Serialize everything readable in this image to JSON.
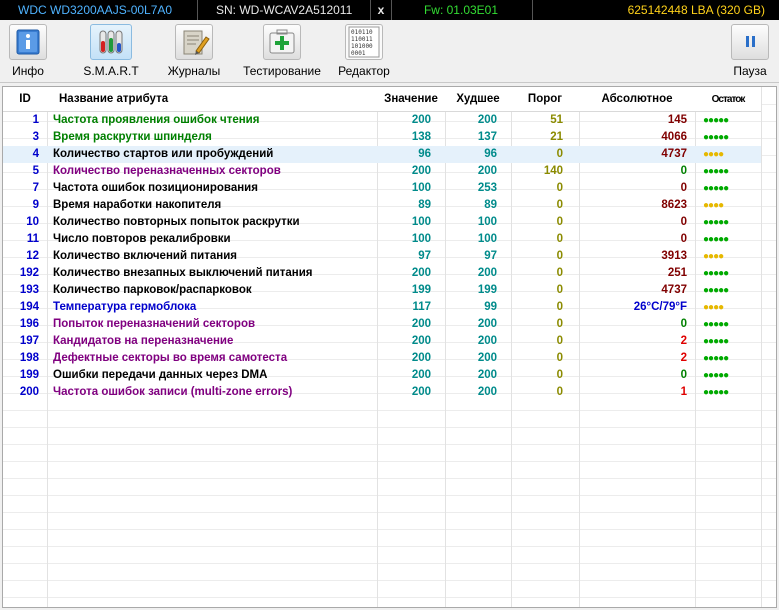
{
  "topbar": {
    "model": "WDC WD3200AAJS-00L7A0",
    "serial": "SN: WD-WCAV2A512011",
    "close": "x",
    "firmware": "Fw: 01.03E01",
    "capacity": "625142448 LBA (320 GB)"
  },
  "toolbar": {
    "info": "Инфо",
    "smart": "S.M.A.R.T",
    "logs": "Журналы",
    "test": "Тестирование",
    "editor": "Редактор",
    "pause": "Пауза",
    "editor_icon_text": [
      "010110",
      "110011",
      "101000",
      "0001"
    ]
  },
  "colors": {
    "teal": "#008b8b",
    "threshold": "#8b8b00",
    "green_name": "#008000",
    "purple_name": "#800080",
    "blue_name": "#0000cc",
    "absolute_red": "#800000",
    "absolute_green": "#008000",
    "bright_red": "#e00000",
    "dots_green": "#00aa00",
    "dots_yellow": "#e6b800",
    "selected_row": "#e5f1fb"
  },
  "table": {
    "headers": {
      "id": "ID",
      "name": "Название атрибута",
      "value": "Значение",
      "worst": "Худшее",
      "threshold": "Порог",
      "absolute": "Абсолютное",
      "remaining": "Остаток"
    },
    "rows": [
      {
        "id": "1",
        "name": "Частота проявления ошибок чтения",
        "value": "200",
        "worst": "200",
        "threshold": "51",
        "absolute": "145",
        "remaining": "●●●●●",
        "name_color": "#008000",
        "id_color": "#0000cc",
        "thr_color": "#8b8b00",
        "abs_color": "#800000",
        "rem_color": "#00aa00"
      },
      {
        "id": "3",
        "name": "Время раскрутки шпинделя",
        "value": "138",
        "worst": "137",
        "threshold": "21",
        "absolute": "4066",
        "remaining": "●●●●●",
        "name_color": "#008000",
        "id_color": "#0000cc",
        "thr_color": "#8b8b00",
        "abs_color": "#800000",
        "rem_color": "#00aa00"
      },
      {
        "id": "4",
        "name": "Количество стартов или пробуждений",
        "value": "96",
        "worst": "96",
        "threshold": "0",
        "absolute": "4737",
        "remaining": "●●●●",
        "name_color": "#000000",
        "id_color": "#0000cc",
        "thr_color": "#8b8b00",
        "abs_color": "#800000",
        "rem_color": "#e6b800"
      },
      {
        "id": "5",
        "name": "Количество переназначенных секторов",
        "value": "200",
        "worst": "200",
        "threshold": "140",
        "absolute": "0",
        "remaining": "●●●●●",
        "name_color": "#800080",
        "id_color": "#0000cc",
        "thr_color": "#8b8b00",
        "abs_color": "#008000",
        "rem_color": "#00aa00"
      },
      {
        "id": "7",
        "name": "Частота ошибок позиционирования",
        "value": "100",
        "worst": "253",
        "threshold": "0",
        "absolute": "0",
        "remaining": "●●●●●",
        "name_color": "#000000",
        "id_color": "#0000cc",
        "thr_color": "#8b8b00",
        "abs_color": "#800000",
        "rem_color": "#00aa00"
      },
      {
        "id": "9",
        "name": "Время наработки накопителя",
        "value": "89",
        "worst": "89",
        "threshold": "0",
        "absolute": "8623",
        "remaining": "●●●●",
        "name_color": "#000000",
        "id_color": "#0000cc",
        "thr_color": "#8b8b00",
        "abs_color": "#800000",
        "rem_color": "#e6b800"
      },
      {
        "id": "10",
        "name": "Количество повторных попыток раскрутки",
        "value": "100",
        "worst": "100",
        "threshold": "0",
        "absolute": "0",
        "remaining": "●●●●●",
        "name_color": "#000000",
        "id_color": "#0000cc",
        "thr_color": "#8b8b00",
        "abs_color": "#800000",
        "rem_color": "#00aa00"
      },
      {
        "id": "11",
        "name": "Число повторов рекалибровки",
        "value": "100",
        "worst": "100",
        "threshold": "0",
        "absolute": "0",
        "remaining": "●●●●●",
        "name_color": "#000000",
        "id_color": "#0000cc",
        "thr_color": "#8b8b00",
        "abs_color": "#800000",
        "rem_color": "#00aa00"
      },
      {
        "id": "12",
        "name": "Количество включений питания",
        "value": "97",
        "worst": "97",
        "threshold": "0",
        "absolute": "3913",
        "remaining": "●●●●",
        "name_color": "#000000",
        "id_color": "#0000cc",
        "thr_color": "#8b8b00",
        "abs_color": "#800000",
        "rem_color": "#e6b800"
      },
      {
        "id": "192",
        "name": "Количество внезапных выключений питания",
        "value": "200",
        "worst": "200",
        "threshold": "0",
        "absolute": "251",
        "remaining": "●●●●●",
        "name_color": "#000000",
        "id_color": "#0000cc",
        "thr_color": "#8b8b00",
        "abs_color": "#800000",
        "rem_color": "#00aa00"
      },
      {
        "id": "193",
        "name": "Количество парковок/распарковок",
        "value": "199",
        "worst": "199",
        "threshold": "0",
        "absolute": "4737",
        "remaining": "●●●●●",
        "name_color": "#000000",
        "id_color": "#0000cc",
        "thr_color": "#8b8b00",
        "abs_color": "#800000",
        "rem_color": "#00aa00"
      },
      {
        "id": "194",
        "name": "Температура гермоблока",
        "value": "117",
        "worst": "99",
        "threshold": "0",
        "absolute": "26°C/79°F",
        "remaining": "●●●●",
        "name_color": "#0000cc",
        "id_color": "#0000cc",
        "thr_color": "#8b8b00",
        "abs_color": "#0000cc",
        "rem_color": "#e6b800"
      },
      {
        "id": "196",
        "name": "Попыток переназначений секторов",
        "value": "200",
        "worst": "200",
        "threshold": "0",
        "absolute": "0",
        "remaining": "●●●●●",
        "name_color": "#800080",
        "id_color": "#0000cc",
        "thr_color": "#8b8b00",
        "abs_color": "#008000",
        "rem_color": "#00aa00"
      },
      {
        "id": "197",
        "name": "Кандидатов на переназначение",
        "value": "200",
        "worst": "200",
        "threshold": "0",
        "absolute": "2",
        "remaining": "●●●●●",
        "name_color": "#800080",
        "id_color": "#0000cc",
        "thr_color": "#8b8b00",
        "abs_color": "#e00000",
        "rem_color": "#00aa00"
      },
      {
        "id": "198",
        "name": "Дефектные секторы во время самотеста",
        "value": "200",
        "worst": "200",
        "threshold": "0",
        "absolute": "2",
        "remaining": "●●●●●",
        "name_color": "#800080",
        "id_color": "#0000cc",
        "thr_color": "#8b8b00",
        "abs_color": "#e00000",
        "rem_color": "#00aa00"
      },
      {
        "id": "199",
        "name": "Ошибки передачи данных через DMA",
        "value": "200",
        "worst": "200",
        "threshold": "0",
        "absolute": "0",
        "remaining": "●●●●●",
        "name_color": "#000000",
        "id_color": "#0000cc",
        "thr_color": "#8b8b00",
        "abs_color": "#008000",
        "rem_color": "#00aa00"
      },
      {
        "id": "200",
        "name": "Частота ошибок записи (multi-zone errors)",
        "value": "200",
        "worst": "200",
        "threshold": "0",
        "absolute": "1",
        "remaining": "●●●●●",
        "name_color": "#800080",
        "id_color": "#0000cc",
        "thr_color": "#8b8b00",
        "abs_color": "#e00000",
        "rem_color": "#00aa00"
      }
    ],
    "selected_row": "4"
  }
}
